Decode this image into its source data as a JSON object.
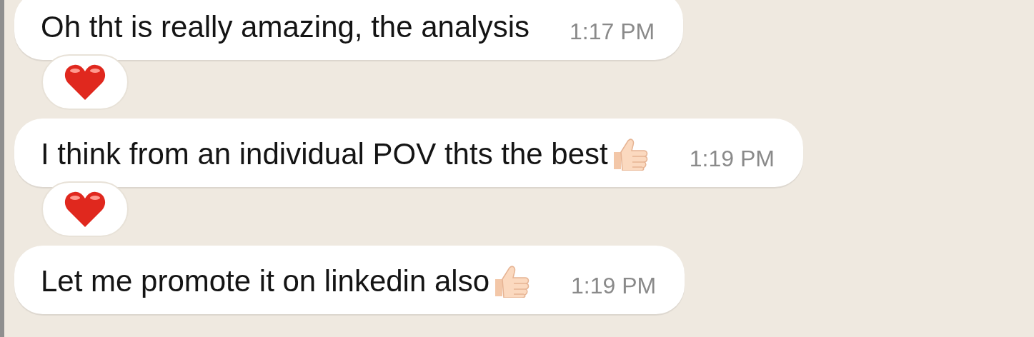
{
  "messages": [
    {
      "text": "Oh tht is really amazing, the analysis",
      "thumbs_up": false,
      "time": "1:17 PM",
      "heart_reaction": true
    },
    {
      "text": "I think from an individual POV thts the best",
      "thumbs_up": true,
      "time": "1:19 PM",
      "heart_reaction": true
    },
    {
      "text": "Let me promote it on linkedin also",
      "thumbs_up": true,
      "time": "1:19 PM",
      "heart_reaction": false
    }
  ]
}
